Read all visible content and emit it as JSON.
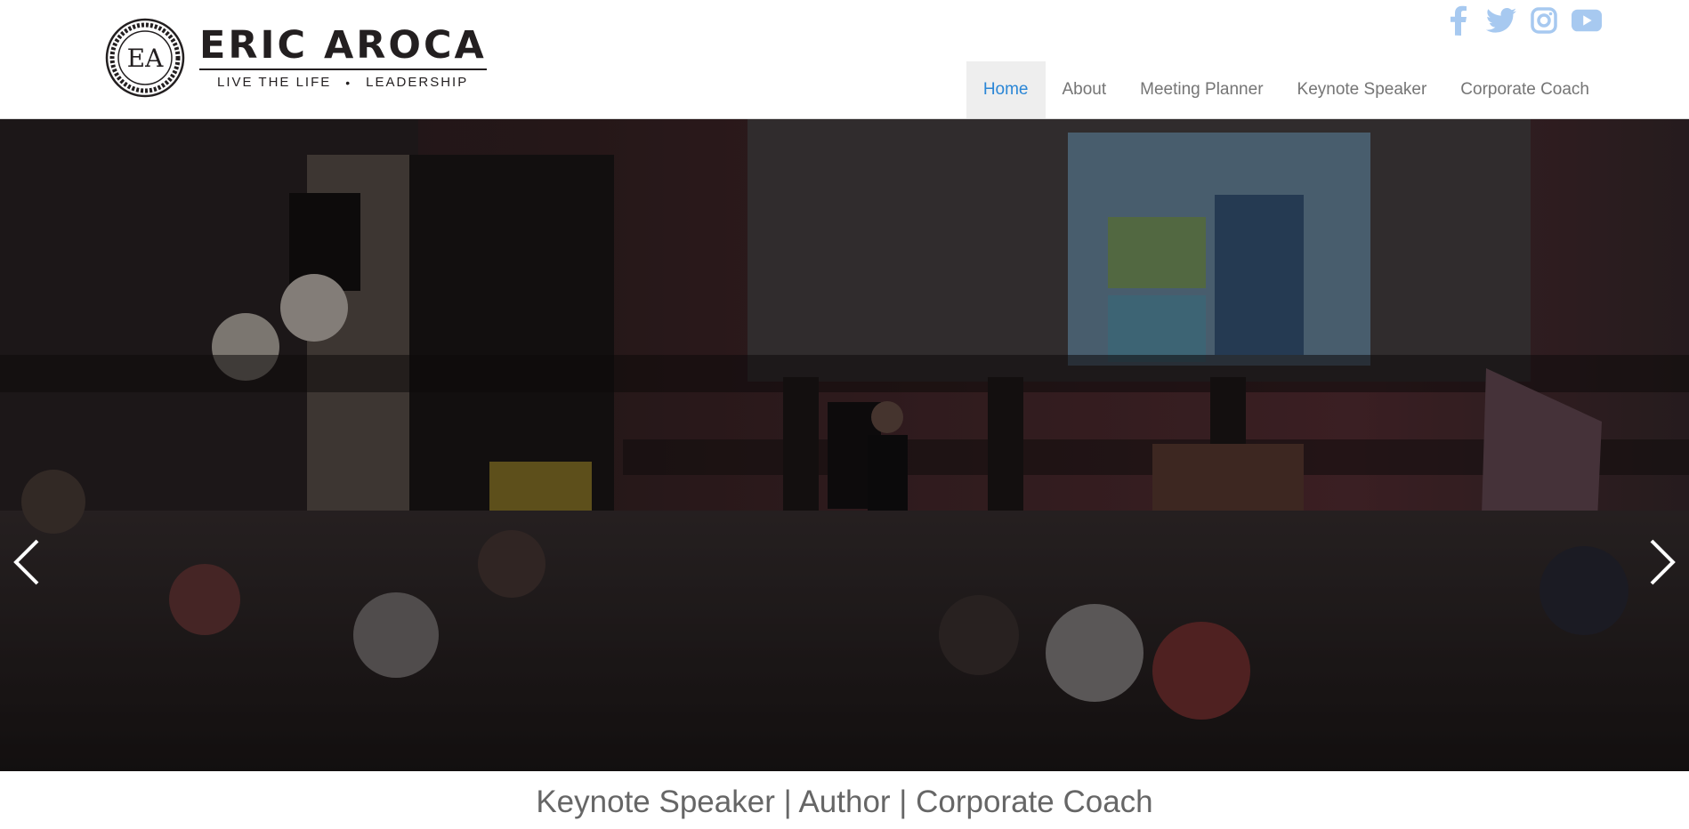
{
  "brand": {
    "seal_text": "EA",
    "name": "ERIC AROCA",
    "tag_left": "LIVE THE LIFE",
    "tag_sep": "•",
    "tag_right": "LEADERSHIP"
  },
  "social": {
    "color": "#a7c9f0",
    "icons": [
      "facebook-icon",
      "twitter-icon",
      "instagram-icon",
      "youtube-icon"
    ]
  },
  "nav": {
    "items": [
      "Home",
      "About",
      "Meeting Planner",
      "Keynote Speaker",
      "Corporate Coach"
    ],
    "active": "Home",
    "active_color": "#2a86d6"
  },
  "hero": {
    "description_icons": [
      "chevron-left-icon",
      "chevron-right-icon"
    ]
  },
  "tagline": "Keynote Speaker | Author | Corporate Coach"
}
